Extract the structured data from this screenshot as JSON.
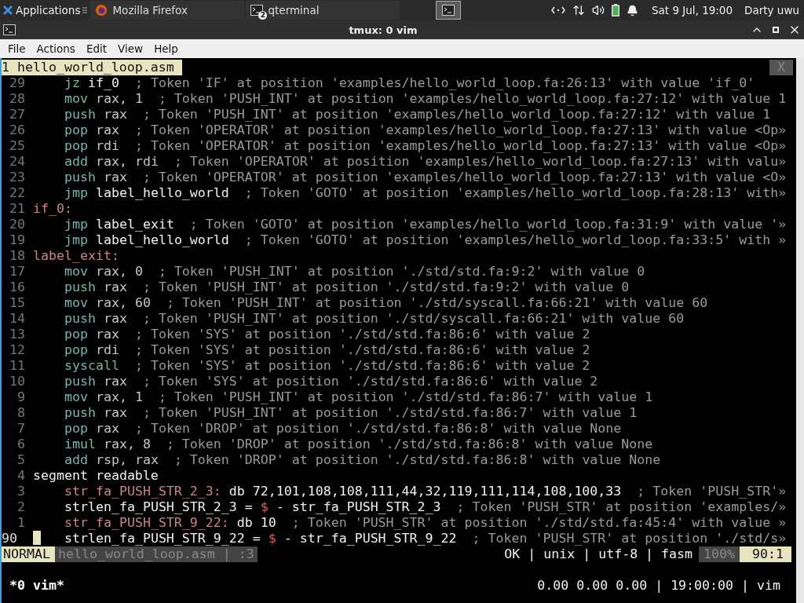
{
  "panel": {
    "apps_label": "Applications",
    "tasks": [
      {
        "kind": "browser",
        "label": "Mozilla Firefox",
        "selected": false
      },
      {
        "kind": "terminal",
        "label": "qterminal",
        "badge": "2",
        "selected": false
      }
    ],
    "launcher": {
      "selected": true
    },
    "clock": "Sat  9 Jul, 19:00",
    "user": "Darty uwu"
  },
  "window": {
    "title": "tmux: 0 vim"
  },
  "menu": [
    "File",
    "Actions",
    "Edit",
    "View",
    "Help"
  ],
  "vim": {
    "tab": {
      "label": "1 hello_world_loop.asm",
      "close": "X"
    },
    "lines": [
      {
        "num": "29",
        "indented": true,
        "current": false,
        "segments": [
          {
            "kind": "kw",
            "text": "jz"
          },
          {
            "kind": "text",
            "text": " if_0"
          },
          {
            "kind": "comment",
            "text": "  ; Token 'IF' at position 'examples/hello_world_loop.fa:26:13' with value 'if_0'"
          }
        ]
      },
      {
        "num": "28",
        "indented": true,
        "current": false,
        "segments": [
          {
            "kind": "kw",
            "text": "mov"
          },
          {
            "kind": "reg",
            "text": " rax, 1"
          },
          {
            "kind": "comment",
            "text": "  ; Token 'PUSH_INT' at position 'examples/hello_world_loop.fa:27:12' with value 1"
          }
        ]
      },
      {
        "num": "27",
        "indented": true,
        "current": false,
        "segments": [
          {
            "kind": "kw",
            "text": "push"
          },
          {
            "kind": "reg",
            "text": " rax"
          },
          {
            "kind": "comment",
            "text": "  ; Token 'PUSH_INT' at position 'examples/hello_world_loop.fa:27:12' with value 1"
          }
        ]
      },
      {
        "num": "26",
        "indented": true,
        "current": false,
        "segments": [
          {
            "kind": "kw",
            "text": "pop"
          },
          {
            "kind": "reg",
            "text": " rax"
          },
          {
            "kind": "comment",
            "text": "  ; Token 'OPERATOR' at position 'examples/hello_world_loop.fa:27:13' with value <Op»"
          }
        ]
      },
      {
        "num": "25",
        "indented": true,
        "current": false,
        "segments": [
          {
            "kind": "kw",
            "text": "pop"
          },
          {
            "kind": "reg",
            "text": " rdi"
          },
          {
            "kind": "comment",
            "text": "  ; Token 'OPERATOR' at position 'examples/hello_world_loop.fa:27:13' with value <Op»"
          }
        ]
      },
      {
        "num": "24",
        "indented": true,
        "current": false,
        "segments": [
          {
            "kind": "kw",
            "text": "add"
          },
          {
            "kind": "reg",
            "text": " rax, rdi"
          },
          {
            "kind": "comment",
            "text": "  ; Token 'OPERATOR' at position 'examples/hello_world_loop.fa:27:13' with valu»"
          }
        ]
      },
      {
        "num": "23",
        "indented": true,
        "current": false,
        "segments": [
          {
            "kind": "kw",
            "text": "push"
          },
          {
            "kind": "reg",
            "text": " rax"
          },
          {
            "kind": "comment",
            "text": "  ; Token 'OPERATOR' at position 'examples/hello_world_loop.fa:27:13' with value <O»"
          }
        ]
      },
      {
        "num": "22",
        "indented": true,
        "current": false,
        "segments": [
          {
            "kind": "kw",
            "text": "jmp"
          },
          {
            "kind": "text",
            "text": " label_hello_world"
          },
          {
            "kind": "comment",
            "text": "  ; Token 'GOTO' at position 'examples/hello_world_loop.fa:28:13' with»"
          }
        ]
      },
      {
        "num": "21",
        "indented": false,
        "current": false,
        "segments": [
          {
            "kind": "label",
            "text": "if_0:"
          }
        ]
      },
      {
        "num": "20",
        "indented": true,
        "current": false,
        "segments": [
          {
            "kind": "kw",
            "text": "jmp"
          },
          {
            "kind": "text",
            "text": " label_exit"
          },
          {
            "kind": "comment",
            "text": "  ; Token 'GOTO' at position 'examples/hello_world_loop.fa:31:9' with value '»"
          }
        ]
      },
      {
        "num": "19",
        "indented": true,
        "current": false,
        "segments": [
          {
            "kind": "kw",
            "text": "jmp"
          },
          {
            "kind": "text",
            "text": " label_hello_world"
          },
          {
            "kind": "comment",
            "text": "  ; Token 'GOTO' at position 'examples/hello_world_loop.fa:33:5' with »"
          }
        ]
      },
      {
        "num": "18",
        "indented": false,
        "current": false,
        "segments": [
          {
            "kind": "label",
            "text": "label_exit:"
          }
        ]
      },
      {
        "num": "17",
        "indented": true,
        "current": false,
        "segments": [
          {
            "kind": "kw",
            "text": "mov"
          },
          {
            "kind": "reg",
            "text": " rax, 0"
          },
          {
            "kind": "comment",
            "text": "  ; Token 'PUSH_INT' at position './std/std.fa:9:2' with value 0"
          }
        ]
      },
      {
        "num": "16",
        "indented": true,
        "current": false,
        "segments": [
          {
            "kind": "kw",
            "text": "push"
          },
          {
            "kind": "reg",
            "text": " rax"
          },
          {
            "kind": "comment",
            "text": "  ; Token 'PUSH_INT' at position './std/std.fa:9:2' with value 0"
          }
        ]
      },
      {
        "num": "15",
        "indented": true,
        "current": false,
        "segments": [
          {
            "kind": "kw",
            "text": "mov"
          },
          {
            "kind": "reg",
            "text": " rax, 60"
          },
          {
            "kind": "comment",
            "text": "  ; Token 'PUSH_INT' at position './std/syscall.fa:66:21' with value 60"
          }
        ]
      },
      {
        "num": "14",
        "indented": true,
        "current": false,
        "segments": [
          {
            "kind": "kw",
            "text": "push"
          },
          {
            "kind": "reg",
            "text": " rax"
          },
          {
            "kind": "comment",
            "text": "  ; Token 'PUSH_INT' at position './std/syscall.fa:66:21' with value 60"
          }
        ]
      },
      {
        "num": "13",
        "indented": true,
        "current": false,
        "segments": [
          {
            "kind": "kw",
            "text": "pop"
          },
          {
            "kind": "reg",
            "text": " rax"
          },
          {
            "kind": "comment",
            "text": "  ; Token 'SYS' at position './std/std.fa:86:6' with value 2"
          }
        ]
      },
      {
        "num": "12",
        "indented": true,
        "current": false,
        "segments": [
          {
            "kind": "kw",
            "text": "pop"
          },
          {
            "kind": "reg",
            "text": " rdi"
          },
          {
            "kind": "comment",
            "text": "  ; Token 'SYS' at position './std/std.fa:86:6' with value 2"
          }
        ]
      },
      {
        "num": "11",
        "indented": true,
        "current": false,
        "segments": [
          {
            "kind": "kw",
            "text": "syscall"
          },
          {
            "kind": "comment",
            "text": "  ; Token 'SYS' at position './std/std.fa:86:6' with value 2"
          }
        ]
      },
      {
        "num": "10",
        "indented": true,
        "current": false,
        "segments": [
          {
            "kind": "kw",
            "text": "push"
          },
          {
            "kind": "reg",
            "text": " rax"
          },
          {
            "kind": "comment",
            "text": "  ; Token 'SYS' at position './std/std.fa:86:6' with value 2"
          }
        ]
      },
      {
        "num": "9",
        "indented": true,
        "current": false,
        "segments": [
          {
            "kind": "kw",
            "text": "mov"
          },
          {
            "kind": "reg",
            "text": " rax, 1"
          },
          {
            "kind": "comment",
            "text": "  ; Token 'PUSH_INT' at position './std/std.fa:86:7' with value 1"
          }
        ]
      },
      {
        "num": "8",
        "indented": true,
        "current": false,
        "segments": [
          {
            "kind": "kw",
            "text": "push"
          },
          {
            "kind": "reg",
            "text": " rax"
          },
          {
            "kind": "comment",
            "text": "  ; Token 'PUSH_INT' at position './std/std.fa:86:7' with value 1"
          }
        ]
      },
      {
        "num": "7",
        "indented": true,
        "current": false,
        "segments": [
          {
            "kind": "kw",
            "text": "pop"
          },
          {
            "kind": "reg",
            "text": " rax"
          },
          {
            "kind": "comment",
            "text": "  ; Token 'DROP' at position './std/std.fa:86:8' with value None"
          }
        ]
      },
      {
        "num": "6",
        "indented": true,
        "current": false,
        "segments": [
          {
            "kind": "kw",
            "text": "imul"
          },
          {
            "kind": "reg",
            "text": " rax, 8"
          },
          {
            "kind": "comment",
            "text": "  ; Token 'DROP' at position './std/std.fa:86:8' with value None"
          }
        ]
      },
      {
        "num": "5",
        "indented": true,
        "current": false,
        "segments": [
          {
            "kind": "kw",
            "text": "add"
          },
          {
            "kind": "reg",
            "text": " rsp, rax"
          },
          {
            "kind": "comment",
            "text": "  ; Token 'DROP' at position './std/std.fa:86:8' with value None"
          }
        ]
      },
      {
        "num": "4",
        "indented": false,
        "current": false,
        "segments": [
          {
            "kind": "text",
            "text": "segment readable"
          }
        ]
      },
      {
        "num": "3",
        "indented": true,
        "current": false,
        "segments": [
          {
            "kind": "label",
            "text": "str_fa_PUSH_STR_2_3:"
          },
          {
            "kind": "text",
            "text": " db 72,101,108,108,111,44,32,119,111,114,108,100,33"
          },
          {
            "kind": "comment",
            "text": "  ; Token 'PUSH_STR'»"
          }
        ]
      },
      {
        "num": "2",
        "indented": true,
        "current": false,
        "segments": [
          {
            "kind": "text",
            "text": "strlen_fa_PUSH_STR_2_3 = "
          },
          {
            "kind": "op",
            "text": "$"
          },
          {
            "kind": "text",
            "text": " - str_fa_PUSH_STR_2_3"
          },
          {
            "kind": "comment",
            "text": "  ; Token 'PUSH_STR' at position 'examples/»"
          }
        ]
      },
      {
        "num": "1",
        "indented": true,
        "current": false,
        "segments": [
          {
            "kind": "label",
            "text": "str_fa_PUSH_STR_9_22:"
          },
          {
            "kind": "text",
            "text": " db 10"
          },
          {
            "kind": "comment",
            "text": "  ; Token 'PUSH_STR' at position './std/std.fa:45:4' with value »"
          }
        ]
      },
      {
        "num": "90",
        "indented": true,
        "current": true,
        "segments": [
          {
            "kind": "text",
            "text": "strlen_fa_PUSH_STR_9_22 = "
          },
          {
            "kind": "op",
            "text": "$"
          },
          {
            "kind": "text",
            "text": " - str_fa_PUSH_STR_9_22"
          },
          {
            "kind": "comment",
            "text": "  ; Token 'PUSH_STR' at position './std/s»"
          }
        ]
      }
    ],
    "status": {
      "mode": "NORMAL",
      "file": "hello_world_loop.asm | :3",
      "info": "OK | unix | utf-8 | fasm",
      "percent": "100%",
      "position": "90:1"
    }
  },
  "tmux": {
    "window": "*0 vim*",
    "right": "0.00 0.00 0.00 | 19:00:00 | vim"
  }
}
